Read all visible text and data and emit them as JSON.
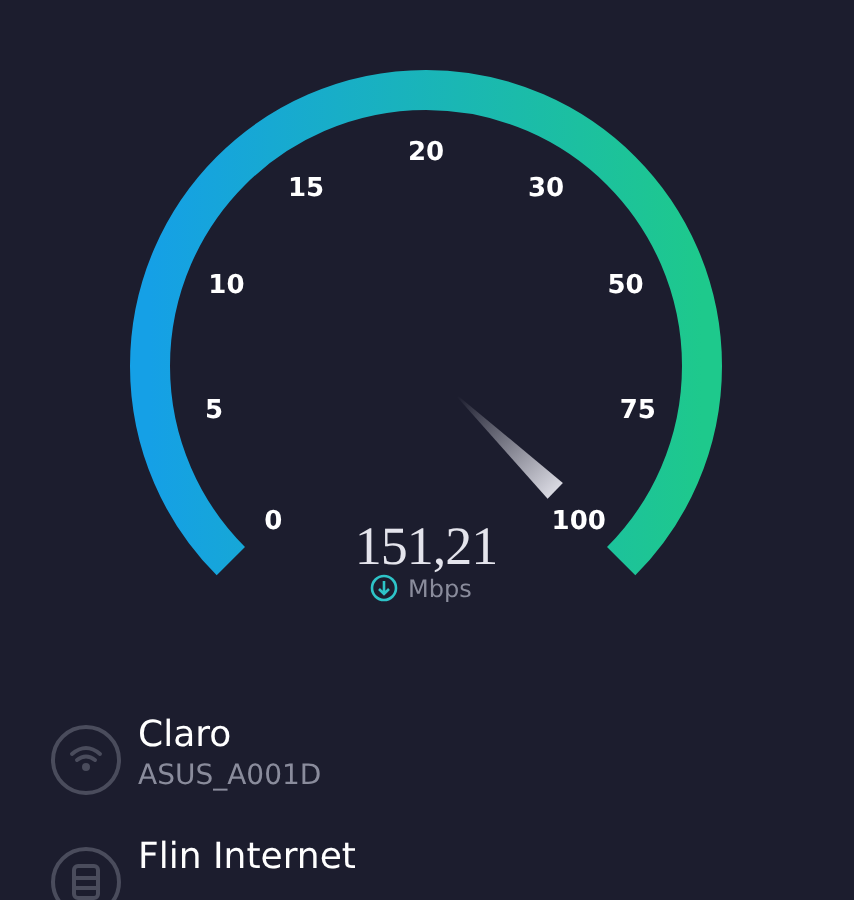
{
  "gauge": {
    "ticks": [
      "0",
      "5",
      "10",
      "15",
      "20",
      "30",
      "50",
      "75",
      "100"
    ],
    "reading": "151,21",
    "unit": "Mbps"
  },
  "connections": [
    {
      "kind": "wifi",
      "name": "Claro",
      "detail": "ASUS_A001D"
    },
    {
      "kind": "server",
      "name": "Flin Internet"
    }
  ]
}
